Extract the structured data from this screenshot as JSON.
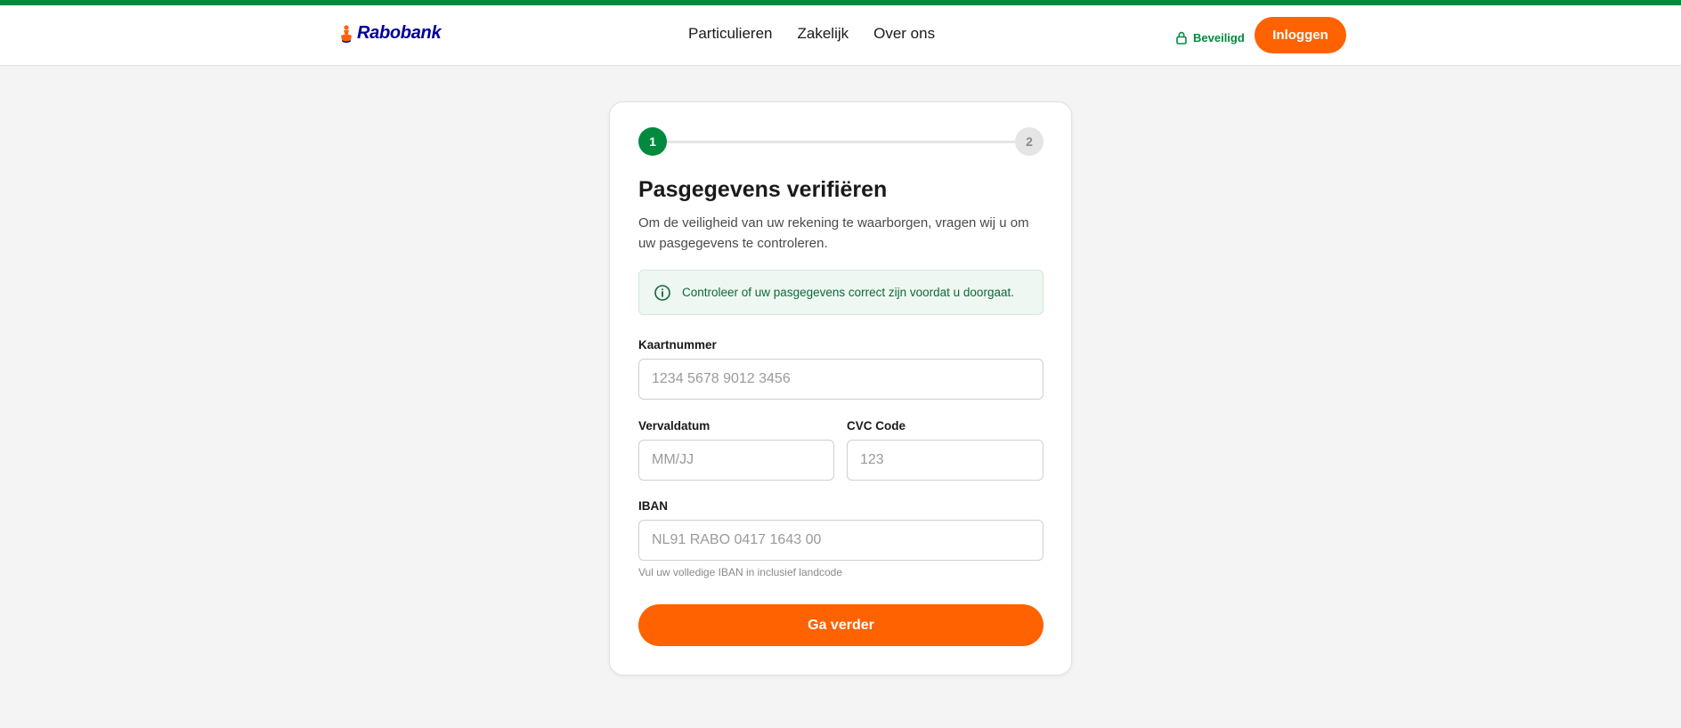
{
  "header": {
    "logo_text": "Rabobank",
    "nav": [
      "Particulieren",
      "Zakelijk",
      "Over ons"
    ],
    "secure_label": "Beveiligd",
    "login_label": "Inloggen"
  },
  "colors": {
    "brand_green": "#008a3e",
    "brand_orange": "#ff6200",
    "logo_blue": "#000099"
  },
  "stepper": {
    "steps": [
      "1",
      "2"
    ],
    "active_step": 1
  },
  "form": {
    "title": "Pasgegevens verifiëren",
    "intro": "Om de veiligheid van uw rekening te waarborgen, vragen wij u om uw pasgegevens te controleren.",
    "notice": "Controleer of uw pasgegevens correct zijn voordat u doorgaat.",
    "card_number": {
      "label": "Kaartnummer",
      "placeholder": "1234 5678 9012 3456"
    },
    "expiry": {
      "label": "Vervaldatum",
      "placeholder": "MM/JJ"
    },
    "cvc": {
      "label": "CVC Code",
      "placeholder": "123"
    },
    "iban": {
      "label": "IBAN",
      "placeholder": "NL91 RABO 0417 1643 00",
      "hint": "Vul uw volledige IBAN in inclusief landcode"
    },
    "submit_label": "Ga verder"
  }
}
